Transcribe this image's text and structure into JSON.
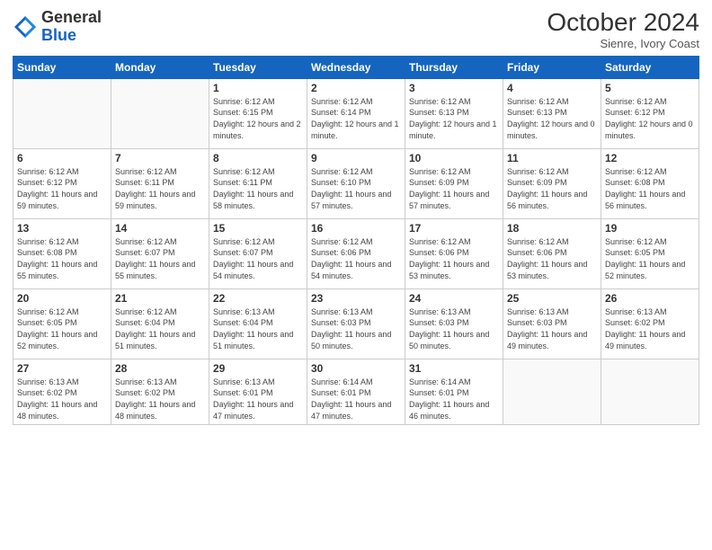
{
  "logo": {
    "general": "General",
    "blue": "Blue"
  },
  "header": {
    "month_year": "October 2024",
    "location": "Sienre, Ivory Coast"
  },
  "days_of_week": [
    "Sunday",
    "Monday",
    "Tuesday",
    "Wednesday",
    "Thursday",
    "Friday",
    "Saturday"
  ],
  "weeks": [
    [
      {
        "day": "",
        "sunrise": "",
        "sunset": "",
        "daylight": "",
        "empty": true
      },
      {
        "day": "",
        "sunrise": "",
        "sunset": "",
        "daylight": "",
        "empty": true
      },
      {
        "day": "1",
        "sunrise": "Sunrise: 6:12 AM",
        "sunset": "Sunset: 6:15 PM",
        "daylight": "Daylight: 12 hours and 2 minutes."
      },
      {
        "day": "2",
        "sunrise": "Sunrise: 6:12 AM",
        "sunset": "Sunset: 6:14 PM",
        "daylight": "Daylight: 12 hours and 1 minute."
      },
      {
        "day": "3",
        "sunrise": "Sunrise: 6:12 AM",
        "sunset": "Sunset: 6:13 PM",
        "daylight": "Daylight: 12 hours and 1 minute."
      },
      {
        "day": "4",
        "sunrise": "Sunrise: 6:12 AM",
        "sunset": "Sunset: 6:13 PM",
        "daylight": "Daylight: 12 hours and 0 minutes."
      },
      {
        "day": "5",
        "sunrise": "Sunrise: 6:12 AM",
        "sunset": "Sunset: 6:12 PM",
        "daylight": "Daylight: 12 hours and 0 minutes."
      }
    ],
    [
      {
        "day": "6",
        "sunrise": "Sunrise: 6:12 AM",
        "sunset": "Sunset: 6:12 PM",
        "daylight": "Daylight: 11 hours and 59 minutes."
      },
      {
        "day": "7",
        "sunrise": "Sunrise: 6:12 AM",
        "sunset": "Sunset: 6:11 PM",
        "daylight": "Daylight: 11 hours and 59 minutes."
      },
      {
        "day": "8",
        "sunrise": "Sunrise: 6:12 AM",
        "sunset": "Sunset: 6:11 PM",
        "daylight": "Daylight: 11 hours and 58 minutes."
      },
      {
        "day": "9",
        "sunrise": "Sunrise: 6:12 AM",
        "sunset": "Sunset: 6:10 PM",
        "daylight": "Daylight: 11 hours and 57 minutes."
      },
      {
        "day": "10",
        "sunrise": "Sunrise: 6:12 AM",
        "sunset": "Sunset: 6:09 PM",
        "daylight": "Daylight: 11 hours and 57 minutes."
      },
      {
        "day": "11",
        "sunrise": "Sunrise: 6:12 AM",
        "sunset": "Sunset: 6:09 PM",
        "daylight": "Daylight: 11 hours and 56 minutes."
      },
      {
        "day": "12",
        "sunrise": "Sunrise: 6:12 AM",
        "sunset": "Sunset: 6:08 PM",
        "daylight": "Daylight: 11 hours and 56 minutes."
      }
    ],
    [
      {
        "day": "13",
        "sunrise": "Sunrise: 6:12 AM",
        "sunset": "Sunset: 6:08 PM",
        "daylight": "Daylight: 11 hours and 55 minutes."
      },
      {
        "day": "14",
        "sunrise": "Sunrise: 6:12 AM",
        "sunset": "Sunset: 6:07 PM",
        "daylight": "Daylight: 11 hours and 55 minutes."
      },
      {
        "day": "15",
        "sunrise": "Sunrise: 6:12 AM",
        "sunset": "Sunset: 6:07 PM",
        "daylight": "Daylight: 11 hours and 54 minutes."
      },
      {
        "day": "16",
        "sunrise": "Sunrise: 6:12 AM",
        "sunset": "Sunset: 6:06 PM",
        "daylight": "Daylight: 11 hours and 54 minutes."
      },
      {
        "day": "17",
        "sunrise": "Sunrise: 6:12 AM",
        "sunset": "Sunset: 6:06 PM",
        "daylight": "Daylight: 11 hours and 53 minutes."
      },
      {
        "day": "18",
        "sunrise": "Sunrise: 6:12 AM",
        "sunset": "Sunset: 6:06 PM",
        "daylight": "Daylight: 11 hours and 53 minutes."
      },
      {
        "day": "19",
        "sunrise": "Sunrise: 6:12 AM",
        "sunset": "Sunset: 6:05 PM",
        "daylight": "Daylight: 11 hours and 52 minutes."
      }
    ],
    [
      {
        "day": "20",
        "sunrise": "Sunrise: 6:12 AM",
        "sunset": "Sunset: 6:05 PM",
        "daylight": "Daylight: 11 hours and 52 minutes."
      },
      {
        "day": "21",
        "sunrise": "Sunrise: 6:12 AM",
        "sunset": "Sunset: 6:04 PM",
        "daylight": "Daylight: 11 hours and 51 minutes."
      },
      {
        "day": "22",
        "sunrise": "Sunrise: 6:13 AM",
        "sunset": "Sunset: 6:04 PM",
        "daylight": "Daylight: 11 hours and 51 minutes."
      },
      {
        "day": "23",
        "sunrise": "Sunrise: 6:13 AM",
        "sunset": "Sunset: 6:03 PM",
        "daylight": "Daylight: 11 hours and 50 minutes."
      },
      {
        "day": "24",
        "sunrise": "Sunrise: 6:13 AM",
        "sunset": "Sunset: 6:03 PM",
        "daylight": "Daylight: 11 hours and 50 minutes."
      },
      {
        "day": "25",
        "sunrise": "Sunrise: 6:13 AM",
        "sunset": "Sunset: 6:03 PM",
        "daylight": "Daylight: 11 hours and 49 minutes."
      },
      {
        "day": "26",
        "sunrise": "Sunrise: 6:13 AM",
        "sunset": "Sunset: 6:02 PM",
        "daylight": "Daylight: 11 hours and 49 minutes."
      }
    ],
    [
      {
        "day": "27",
        "sunrise": "Sunrise: 6:13 AM",
        "sunset": "Sunset: 6:02 PM",
        "daylight": "Daylight: 11 hours and 48 minutes."
      },
      {
        "day": "28",
        "sunrise": "Sunrise: 6:13 AM",
        "sunset": "Sunset: 6:02 PM",
        "daylight": "Daylight: 11 hours and 48 minutes."
      },
      {
        "day": "29",
        "sunrise": "Sunrise: 6:13 AM",
        "sunset": "Sunset: 6:01 PM",
        "daylight": "Daylight: 11 hours and 47 minutes."
      },
      {
        "day": "30",
        "sunrise": "Sunrise: 6:14 AM",
        "sunset": "Sunset: 6:01 PM",
        "daylight": "Daylight: 11 hours and 47 minutes."
      },
      {
        "day": "31",
        "sunrise": "Sunrise: 6:14 AM",
        "sunset": "Sunset: 6:01 PM",
        "daylight": "Daylight: 11 hours and 46 minutes."
      },
      {
        "day": "",
        "sunrise": "",
        "sunset": "",
        "daylight": "",
        "empty": true
      },
      {
        "day": "",
        "sunrise": "",
        "sunset": "",
        "daylight": "",
        "empty": true
      }
    ]
  ]
}
